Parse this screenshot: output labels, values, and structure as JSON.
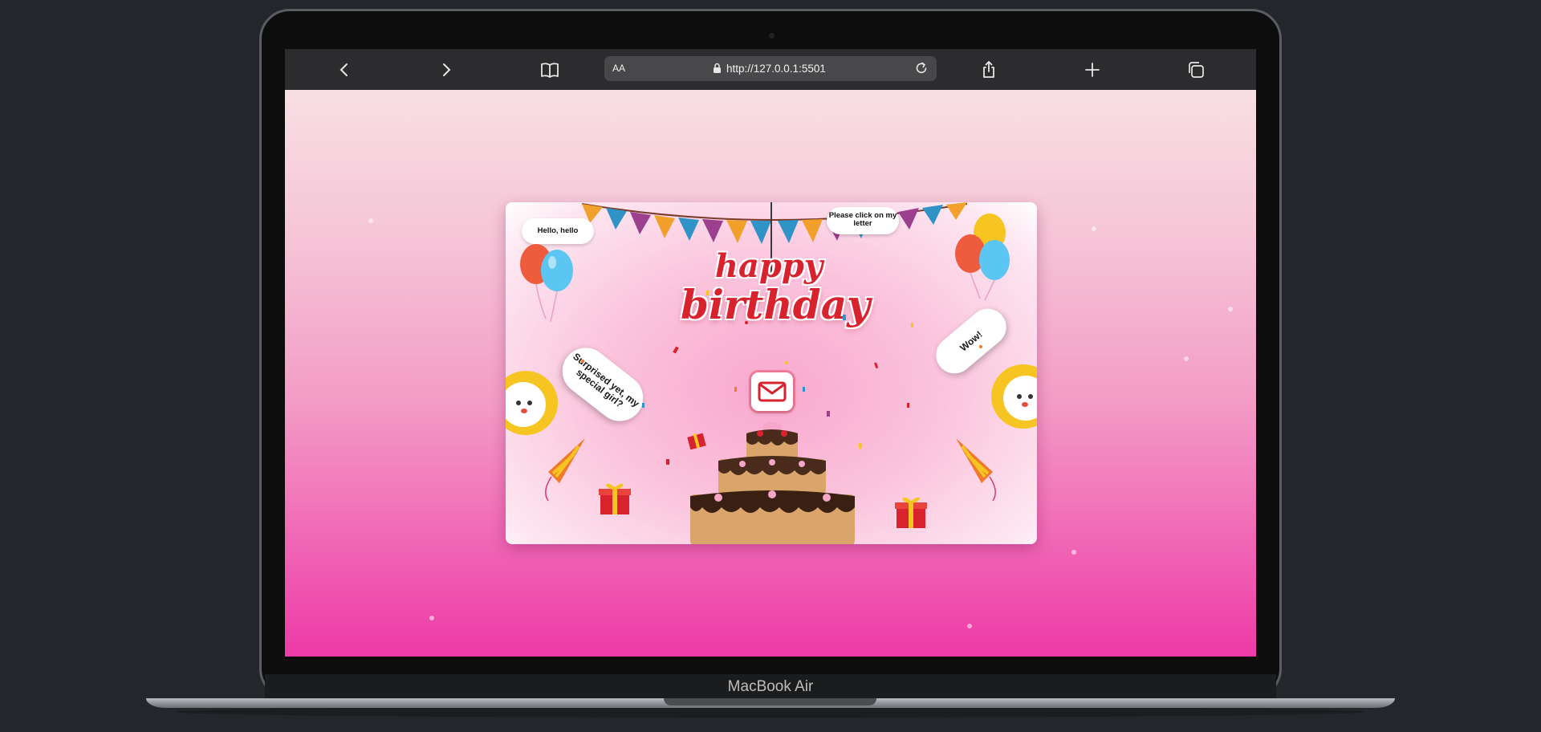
{
  "laptop": {
    "label": "MacBook Air"
  },
  "browser": {
    "text_size_label": "AA",
    "url": "http://127.0.0.1:5501"
  },
  "card": {
    "title_line1": "happy",
    "title_line2": "birthday",
    "cloud_left": "Hello, hello",
    "cloud_right": "Please click on my letter",
    "bubble_left": "Surprised yet, my special girl?",
    "bubble_right": "Wow!"
  },
  "colors": {
    "title_red": "#d8232e",
    "page_top": "#f8dfe4",
    "page_bottom": "#ee3aa7"
  },
  "icons": [
    "back-icon",
    "forward-icon",
    "bookmarks-icon",
    "lock-icon",
    "reload-icon",
    "share-icon",
    "new-tab-icon",
    "tabs-icon",
    "envelope-icon"
  ]
}
